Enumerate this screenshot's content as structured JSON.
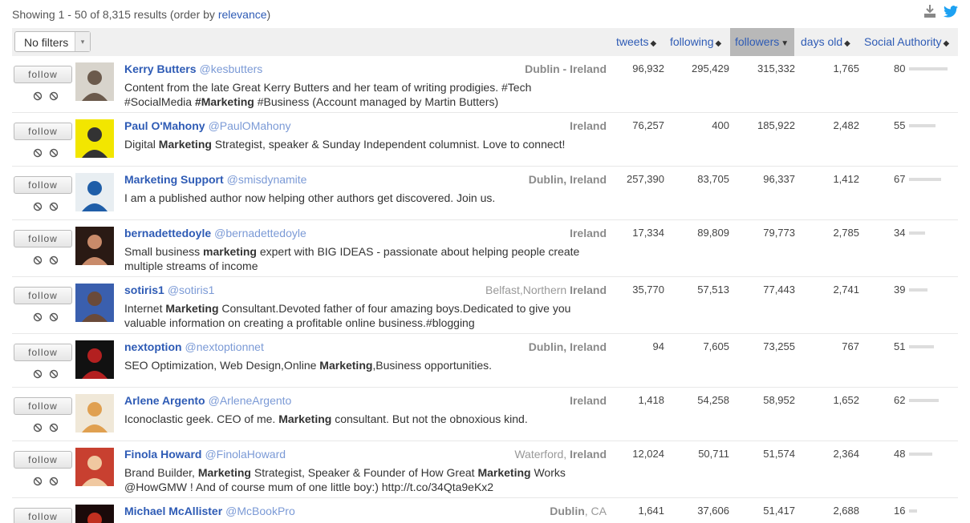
{
  "summary": {
    "prefix": "Showing 1 - 50 of 8,315 results (order by ",
    "link": "relevance",
    "suffix": ")"
  },
  "icons": {
    "download": "download-icon",
    "twitter": "twitter-icon"
  },
  "filter": {
    "label": "No filters"
  },
  "columns": [
    {
      "label": "tweets",
      "active": false
    },
    {
      "label": "following",
      "active": false
    },
    {
      "label": "followers",
      "active": true
    },
    {
      "label": "days old",
      "active": false
    },
    {
      "label": "Social Authority",
      "active": false
    }
  ],
  "follow_label": "follow",
  "accent": "#2e5bb5",
  "rows": [
    {
      "name": "Kerry Butters",
      "handle": "@kesbutters",
      "loc_plain": "",
      "loc_bold": "Dublin - Ireland",
      "bio_parts": [
        "Content from the late Great Kerry Butters and her team of writing prodigies. #Tech #SocialMedia ",
        "#Marketing",
        " #Business (Account managed by Martin Butters)"
      ],
      "tweets": "96,932",
      "following": "295,429",
      "followers": "315,332",
      "days_old": "1,765",
      "authority": "80",
      "authority_value": 80
    },
    {
      "name": "Paul O'Mahony",
      "handle": "@PaulOMahony",
      "loc_plain": "",
      "loc_bold": "Ireland",
      "bio_parts": [
        "Digital ",
        "Marketing",
        " Strategist, speaker & Sunday Independent columnist. Love to connect!"
      ],
      "tweets": "76,257",
      "following": "400",
      "followers": "185,922",
      "days_old": "2,482",
      "authority": "55",
      "authority_value": 55
    },
    {
      "name": "Marketing Support",
      "handle": "@smisdynamite",
      "loc_plain": "",
      "loc_bold": "Dublin, Ireland",
      "bio_parts": [
        "I am a published author now helping other authors get discovered. Join us.",
        "",
        ""
      ],
      "tweets": "257,390",
      "following": "83,705",
      "followers": "96,337",
      "days_old": "1,412",
      "authority": "67",
      "authority_value": 67
    },
    {
      "name": "bernadettedoyle",
      "handle": "@bernadettedoyle",
      "loc_plain": "",
      "loc_bold": "Ireland",
      "bio_parts": [
        "Small business ",
        "marketing",
        " expert with BIG IDEAS - passionate about helping people create multiple streams of income"
      ],
      "tweets": "17,334",
      "following": "89,809",
      "followers": "79,773",
      "days_old": "2,785",
      "authority": "34",
      "authority_value": 34
    },
    {
      "name": "sotiris1",
      "handle": "@sotiris1",
      "loc_plain": "Belfast,Northern ",
      "loc_bold": "Ireland",
      "bio_parts": [
        "Internet ",
        "Marketing",
        " Consultant.Devoted father of four amazing boys.Dedicated to give you valuable information on creating a profitable online business.#blogging"
      ],
      "tweets": "35,770",
      "following": "57,513",
      "followers": "77,443",
      "days_old": "2,741",
      "authority": "39",
      "authority_value": 39
    },
    {
      "name": "nextoption",
      "handle": "@nextoptionnet",
      "loc_plain": "",
      "loc_bold": "Dublin, Ireland",
      "bio_parts": [
        "SEO Optimization, Web Design,Online ",
        "Marketing",
        ",Business opportunities."
      ],
      "tweets": "94",
      "following": "7,605",
      "followers": "73,255",
      "days_old": "767",
      "authority": "51",
      "authority_value": 51
    },
    {
      "name": "Arlene Argento",
      "handle": "@ArleneArgento",
      "loc_plain": "",
      "loc_bold": "Ireland",
      "bio_parts": [
        "Iconoclastic geek. CEO of me. ",
        "Marketing",
        " consultant. But not the obnoxious kind."
      ],
      "tweets": "1,418",
      "following": "54,258",
      "followers": "58,952",
      "days_old": "1,652",
      "authority": "62",
      "authority_value": 62
    },
    {
      "name": "Finola Howard",
      "handle": "@FinolaHoward",
      "loc_plain": "Waterford, ",
      "loc_bold": "Ireland",
      "bio_parts": [
        "Brand Builder, ",
        "Marketing",
        " Strategist, Speaker & Founder of How Great ",
        "Marketing",
        " Works @HowGMW ! And of course mum of one little boy:) http://t.co/34Qta9eKx2"
      ],
      "tweets": "12,024",
      "following": "50,711",
      "followers": "51,574",
      "days_old": "2,364",
      "authority": "48",
      "authority_value": 48
    },
    {
      "name": "Michael McAllister",
      "handle": "@McBookPro",
      "loc_plain": "",
      "loc_bold": "Dublin",
      "loc_tail": ", CA",
      "bio_parts": [
        "",
        "",
        ""
      ],
      "tweets": "1,641",
      "following": "37,606",
      "followers": "51,417",
      "days_old": "2,688",
      "authority": "16",
      "authority_value": 16
    }
  ]
}
